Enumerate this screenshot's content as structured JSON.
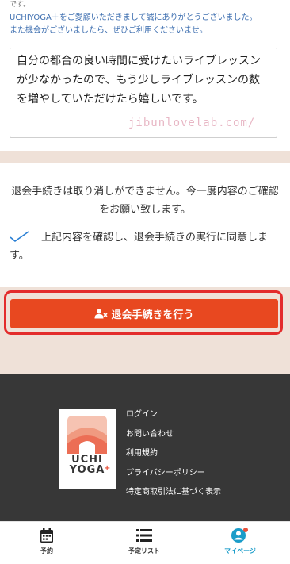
{
  "top": {
    "cut_line": "です。",
    "thanks_line1": "UCHIYOGA＋をご愛顧いただきまして誠にありがとうございました。",
    "thanks_line2": "また機会がございましたら、ぜひご利用くださいませ。",
    "feedback_value": "自分の都合の良い時間に受けたいライブレッスンが少なかったので、もう少しライブレッスンの数を増やしていただけたら嬉しいです。",
    "watermark": "jibunlovelab.com/"
  },
  "notice": {
    "text": "退会手続きは取り消しができません。今一度内容のご確認をお願い致します。",
    "agree_label": "上記内容を確認し、退会手続きの実行に同意します。"
  },
  "action": {
    "button_label": "退会手続きを行う",
    "button_color": "#e84820",
    "highlight_color": "#e32c2c"
  },
  "footer": {
    "logo_line1": "UCHI",
    "logo_line2": "YOGA",
    "logo_plus": "+",
    "links": [
      "ログイン",
      "お問い合わせ",
      "利用規約",
      "プライバシーポリシー",
      "特定商取引法に基づく表示"
    ]
  },
  "tabbar": {
    "tabs": [
      {
        "label": "予約",
        "icon": "calendar-icon"
      },
      {
        "label": "予定リスト",
        "icon": "list-icon"
      },
      {
        "label": "マイページ",
        "icon": "user-icon",
        "active": true
      }
    ],
    "active_color": "#1a9cc9"
  }
}
